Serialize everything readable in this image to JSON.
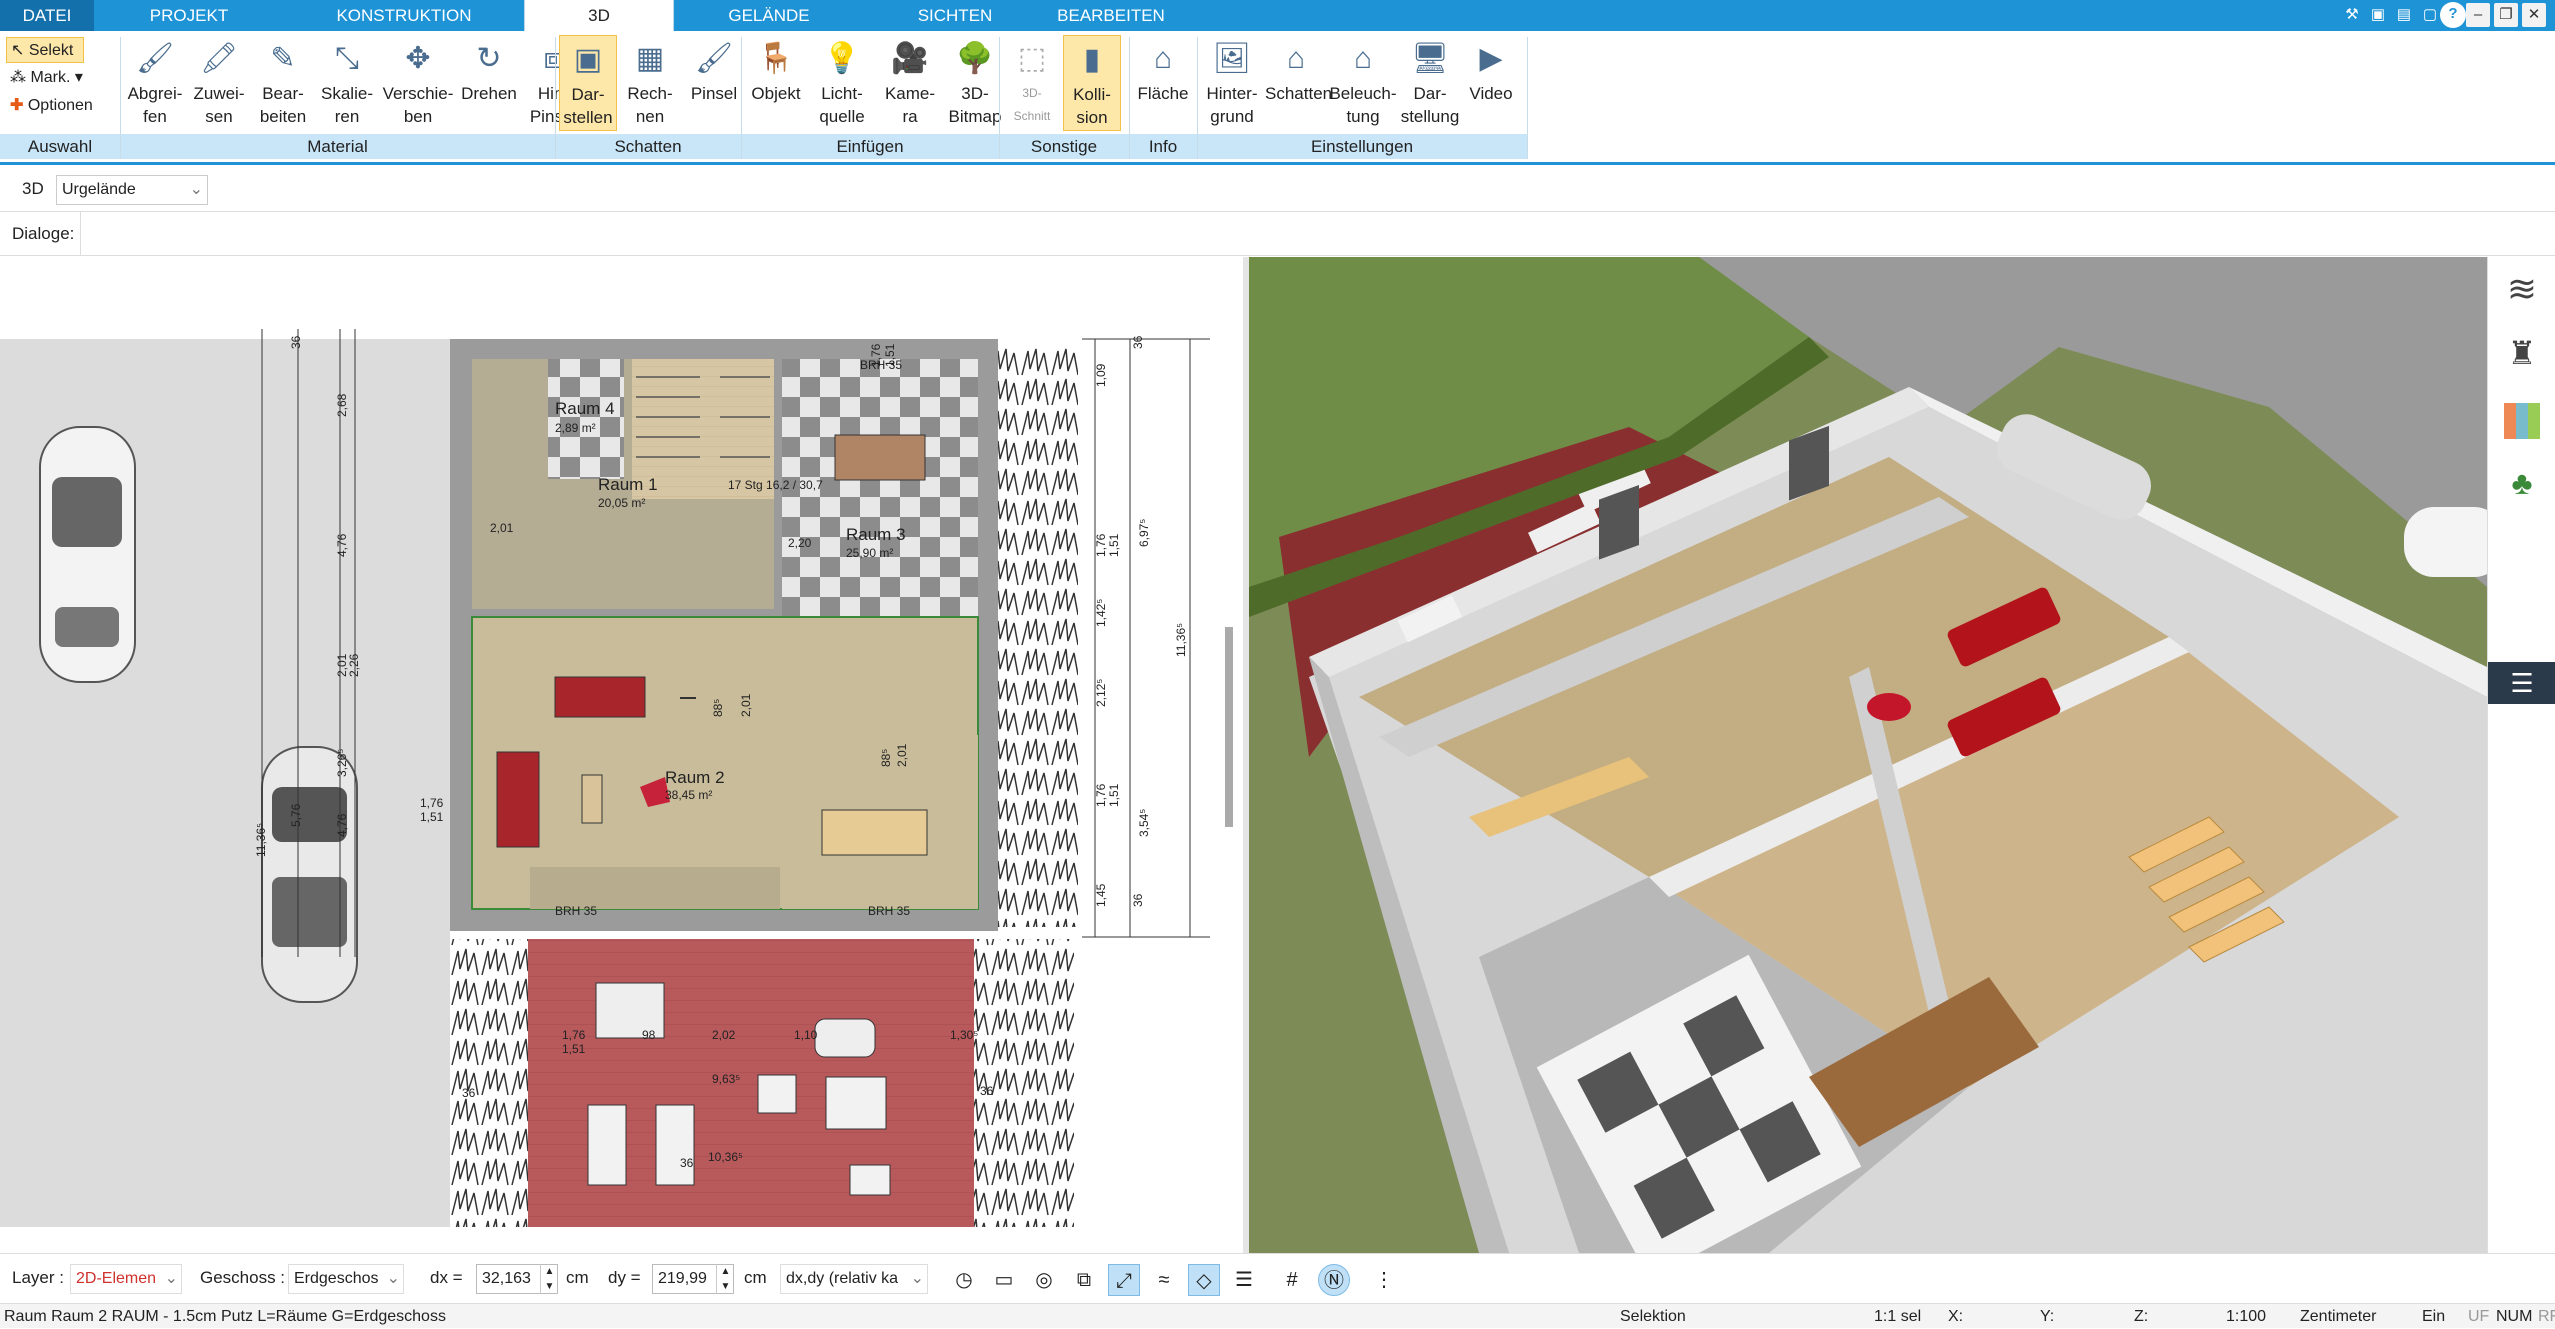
{
  "tabs": [
    "DATEI",
    "PROJEKT",
    "KONSTRUKTION",
    "3D",
    "GELÄNDE",
    "SICHTEN",
    "BEARBEITEN"
  ],
  "ribbon": {
    "auswahl": {
      "selekt": "Selekt",
      "mark": "Mark.",
      "optionen": "Optionen",
      "section": "Auswahl"
    },
    "material": {
      "buttons": [
        "Abgrei-\nfen",
        "Zuwei-\nsen",
        "Bear-\nbeiten",
        "Skalie-\nren",
        "Verschie-\nben",
        "Drehen",
        "Hin.\nPinsel"
      ],
      "section": "Material"
    },
    "schatten": {
      "buttons": [
        "Dar-\nstellen",
        "Rech-\nnen",
        "Pinsel"
      ],
      "section": "Schatten"
    },
    "einfuegen": {
      "buttons": [
        "Objekt",
        "Licht-\nquelle",
        "Kame-\nra",
        "3D-\nBitmap"
      ],
      "section": "Einfügen"
    },
    "sonstige": {
      "buttons": [
        "3D-\nSchnitt",
        "Kolli-\nsion"
      ],
      "section": "Sonstige"
    },
    "info": {
      "buttons": [
        "Fläche"
      ],
      "section": "Info"
    },
    "einstellungen": {
      "buttons": [
        "Hinter-\ngrund",
        "Schatten",
        "Beleuch-\ntung",
        "Dar-\nstellung",
        "Video"
      ],
      "section": "Einstellungen"
    }
  },
  "toolrow": {
    "mode": "3D",
    "dropdown_value": "Urgelände"
  },
  "dialogrow": {
    "label": "Dialoge:"
  },
  "plan": {
    "rooms": [
      {
        "name": "Raum 4",
        "area": "2,89 m²"
      },
      {
        "name": "Raum 1",
        "area": "20,05 m²"
      },
      {
        "name": "Raum 3",
        "area": "25,90 m²"
      },
      {
        "name": "Raum 2",
        "area": "38,45 m²"
      }
    ],
    "dims": {
      "d1": "11,36⁵",
      "d2": "4,76",
      "d3": "2,68",
      "d4": "2,01",
      "d5": "2,26",
      "d6": "3,26⁵",
      "d7": "5,76",
      "d8": "4,76",
      "d9": "1,76",
      "d10": "1,51",
      "d11": "1,76",
      "d12": "1,51",
      "d13": "1,09",
      "d14": "1,76",
      "d15": "1,51",
      "d16": "1,42⁵",
      "d17": "6,97⁵",
      "d18": "2,12⁵",
      "d19": "3,54⁵",
      "d20": "1,45",
      "d21": "11,36⁵",
      "d22": "1,76",
      "d23": "1,51",
      "d24": "2,02",
      "d25": "1,30⁵",
      "d26": "9,63⁵",
      "d27": "10,36⁵",
      "d28": "36",
      "d29": "36",
      "d30": "BRH 35",
      "d31": "BRH 35",
      "d32": "BRH 35",
      "d33": "2,01",
      "d34": "88⁵",
      "d35": "2,01",
      "d36": "88⁵",
      "d37": "2,01",
      "d38": "17 Stg\n16,2 / 30,7",
      "d39": "2,20",
      "d40": "1,10",
      "d41": "98",
      "d42": "36",
      "d43": "36",
      "d44": "36",
      "d45": "36",
      "d46": "1,76",
      "d47": "1,51"
    }
  },
  "bottombar": {
    "layer_label": "Layer :",
    "layer_value": "2D-Elemen",
    "geschoss_label": "Geschoss :",
    "geschoss_value": "Erdgeschos",
    "dx_label": "dx =",
    "dx_value": "32,163",
    "dx_unit": "cm",
    "dy_label": "dy =",
    "dy_value": "219,99",
    "dy_unit": "cm",
    "mode_value": "dx,dy (relativ ka"
  },
  "status": {
    "left": "Raum Raum 2 RAUM - 1.5cm Putz L=Räume G=Erdgeschoss",
    "selektion": "Selektion",
    "sel": "1:1 sel",
    "x": "X:",
    "y": "Y:",
    "z": "Z:",
    "scale": "1:100",
    "unit": "Zentimeter",
    "ein": "Ein",
    "uf": "UF",
    "num": "NUM",
    "rf": "RF"
  },
  "colors": {
    "accent": "#1e93d6",
    "ribbon_section": "#c8e6f8",
    "selected": "#fde7a9"
  }
}
